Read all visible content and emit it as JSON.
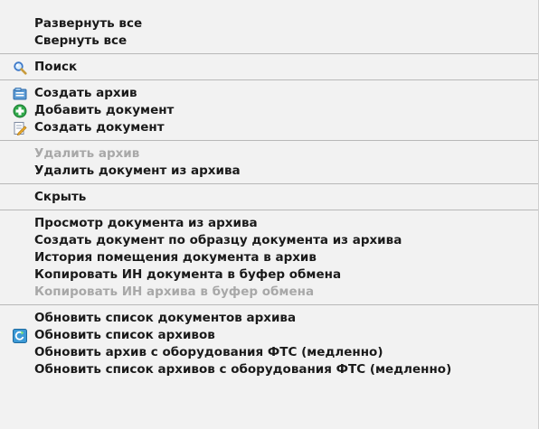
{
  "menu": {
    "expand_all": "Развернуть все",
    "collapse_all": "Свернуть все",
    "search": "Поиск",
    "create_archive": "Создать архив",
    "add_document": "Добавить документ",
    "create_document": "Создать документ",
    "delete_archive": "Удалить архив",
    "delete_document_from_archive": "Удалить документ из архива",
    "hide": "Скрыть",
    "view_document_from_archive": "Просмотр документа из архива",
    "create_document_by_sample": "Создать документ по образцу документа из архива",
    "document_placement_history": "История помещения документа в архив",
    "copy_doc_id": "Копировать ИН документа в буфер обмена",
    "copy_archive_id": "Копировать ИН архива в буфер обмена",
    "refresh_document_list": "Обновить список документов архива",
    "refresh_archive_list": "Обновить список архивов",
    "refresh_archive_from_fts": "Обновить архив с оборудования ФТС (медленно)",
    "refresh_archive_list_from_fts": "Обновить список архивов с оборудования ФТС (медленно)"
  },
  "icons": {
    "search": "magnifier-icon",
    "create_archive": "archive-folder-icon",
    "add_document": "green-plus-icon",
    "create_document": "document-pencil-icon",
    "refresh_archive_list": "refresh-arrow-icon"
  },
  "colors": {
    "menu_background": "#f2f2f2",
    "text": "#1a1a1a",
    "disabled_text": "#a8a8a8",
    "separator": "#b8b8b8"
  }
}
